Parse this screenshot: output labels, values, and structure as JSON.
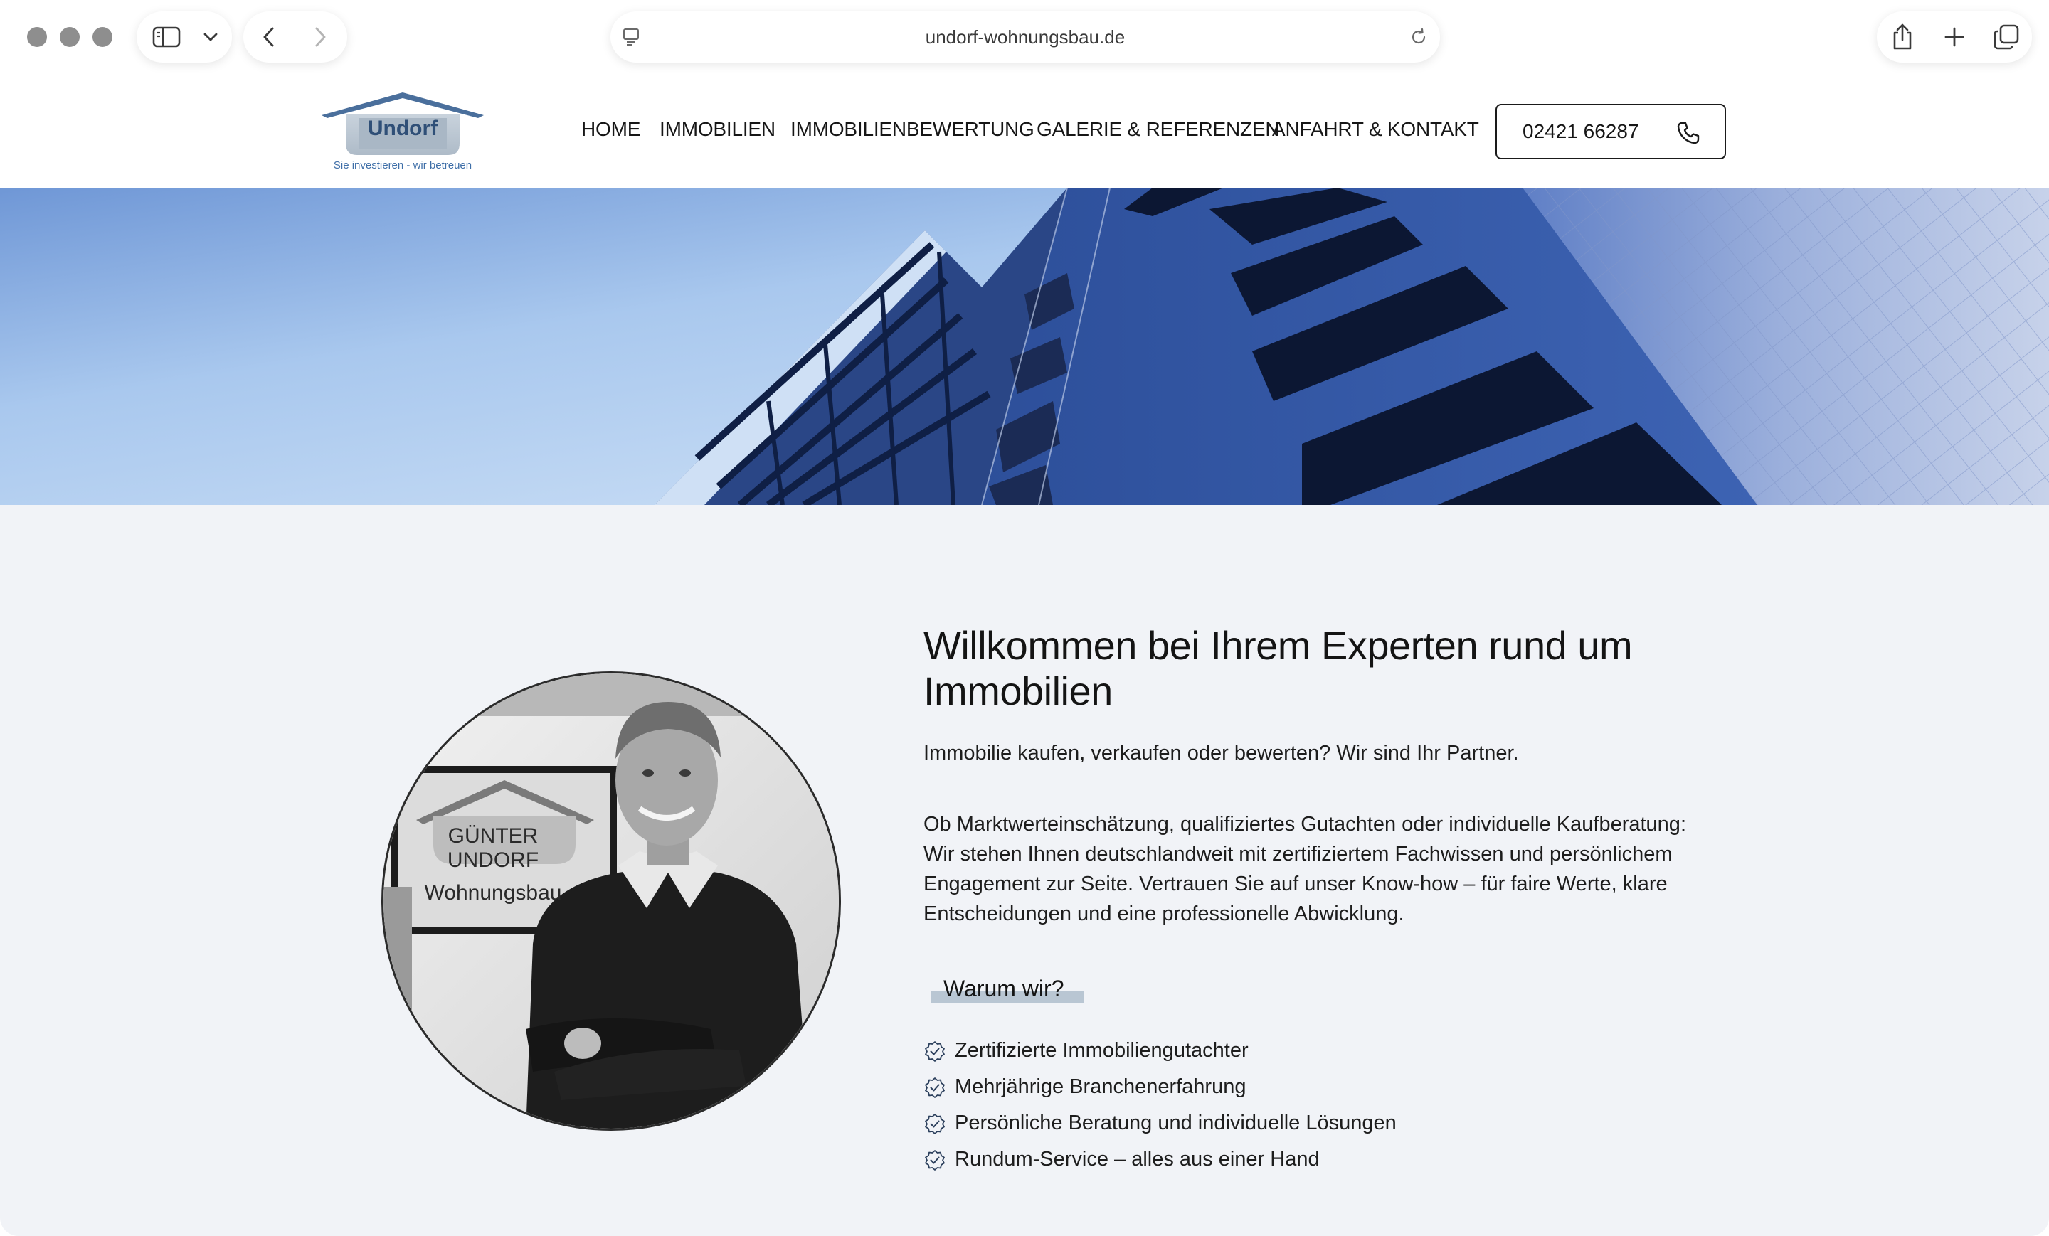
{
  "browser": {
    "url": "undorf-wohnungsbau.de"
  },
  "header": {
    "logo": {
      "name": "Undorf",
      "tagline": "Sie investieren - wir betreuen"
    },
    "nav": [
      {
        "label": "HOME"
      },
      {
        "label": "IMMOBILIEN"
      },
      {
        "label": "IMMOBILIENBEWERTUNG"
      },
      {
        "label": "GALERIE & REFERENZEN"
      },
      {
        "label": "ANFAHRT & KONTAKT"
      }
    ],
    "phone": "02421 66287"
  },
  "portrait": {
    "sign_line1": "GÜNTER",
    "sign_line2": "UNDORF",
    "sign_line3": "Wohnungsbau"
  },
  "main": {
    "heading": "Willkommen bei Ihrem Experten rund um Immobilien",
    "lead": "Immobilie kaufen, verkaufen oder bewerten? Wir sind Ihr Partner.",
    "body": "Ob Marktwerteinschätzung, qualifiziertes Gutachten oder individuelle Kaufberatung: Wir stehen Ihnen deutschlandweit mit zertifiziertem Fachwissen und persönlichem Engagement zur Seite. Vertrauen Sie auf unser Know-how – für faire Werte, klare Entscheidungen und eine professionelle Abwicklung.",
    "why_title": "Warum wir?",
    "why_items": [
      "Zertifizierte Immobiliengutachter",
      "Mehrjährige Branchenerfahrung",
      "Persönliche Beratung und individuelle Lösungen",
      "Rundum-Service – alles aus einer Hand"
    ]
  },
  "colors": {
    "brand_blue": "#4a6f9c",
    "page_background": "#f1f3f7",
    "accent_bar": "#b9c6d3"
  }
}
